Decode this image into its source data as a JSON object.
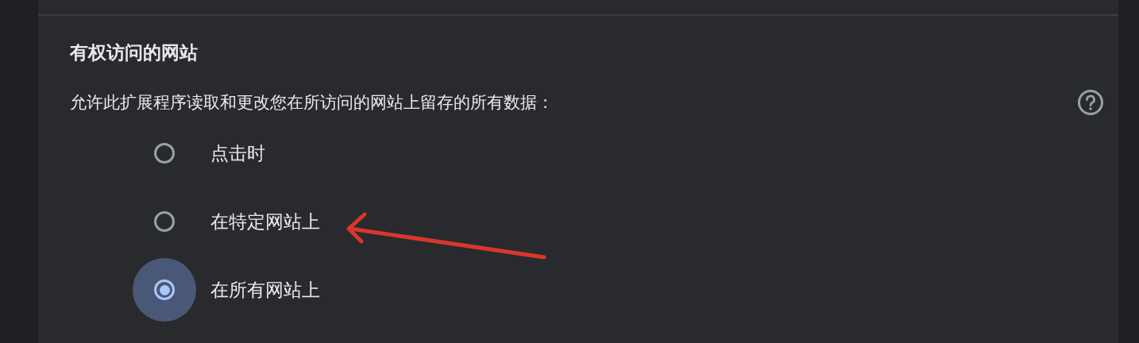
{
  "section": {
    "title": "有权访问的网站",
    "description": "允许此扩展程序读取和更改您在所访问的网站上留存的所有数据：",
    "options": [
      {
        "label": "点击时",
        "selected": false
      },
      {
        "label": "在特定网站上",
        "selected": false
      },
      {
        "label": "在所有网站上",
        "selected": true
      }
    ]
  }
}
